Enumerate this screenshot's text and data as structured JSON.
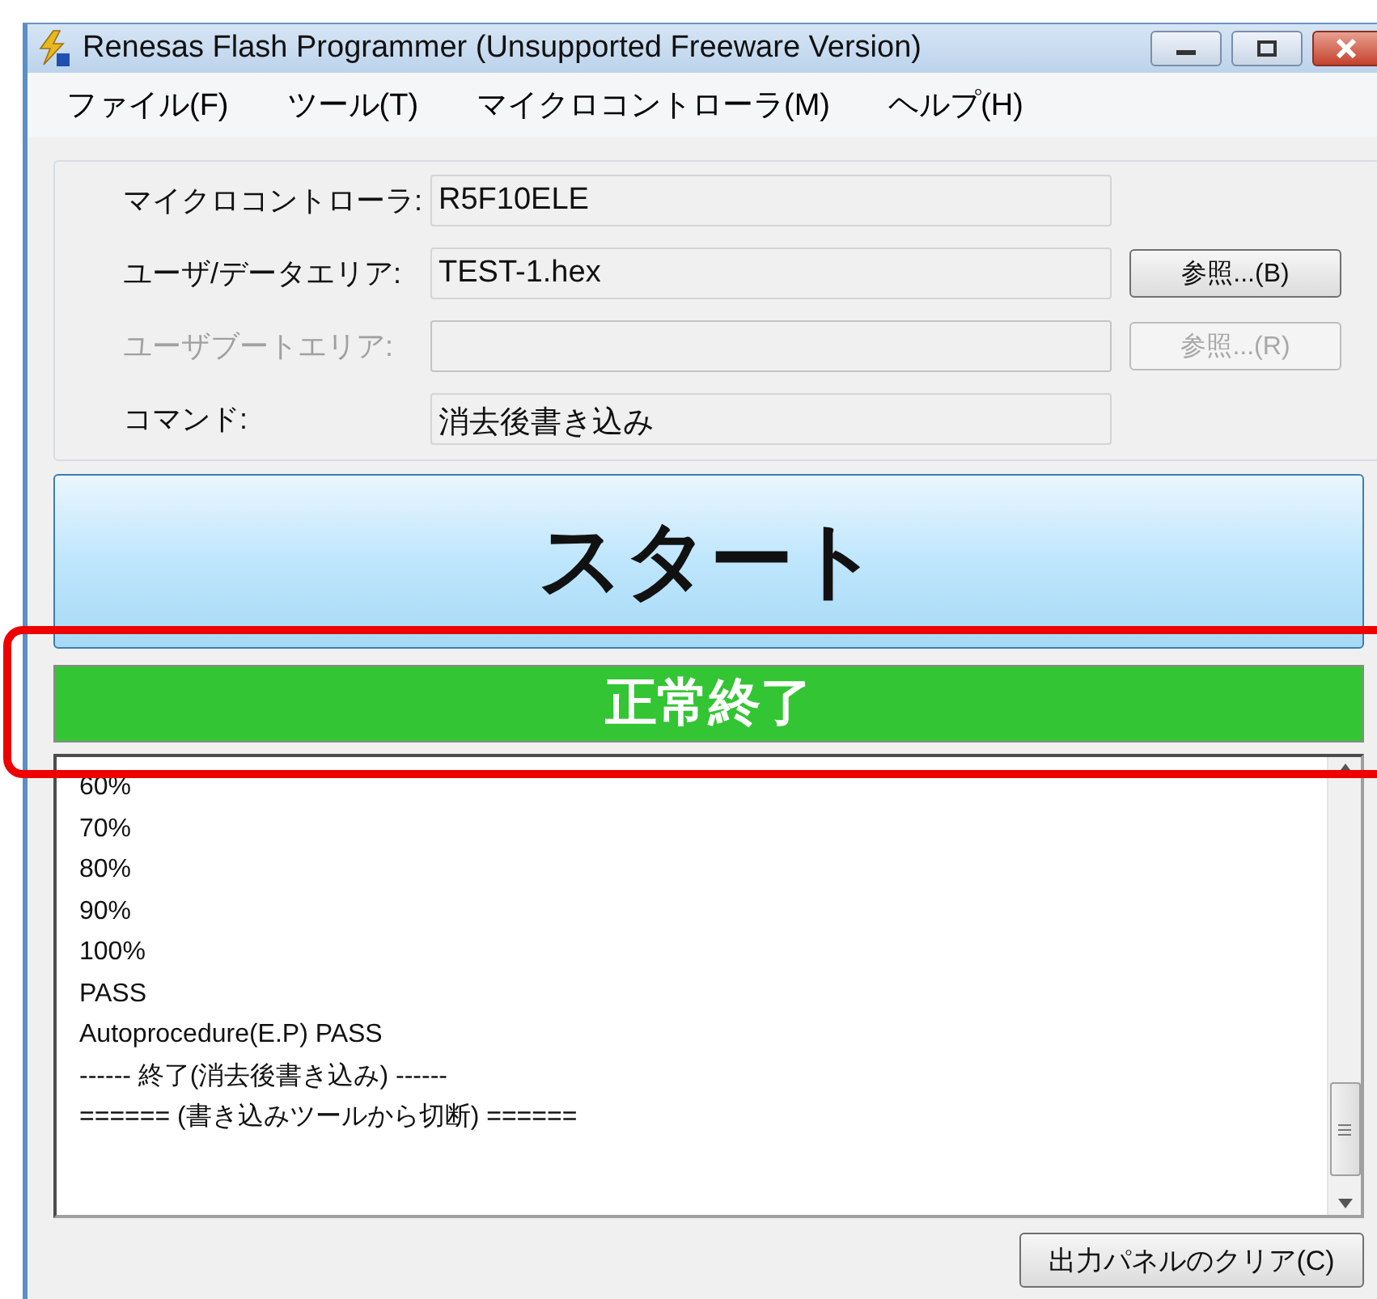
{
  "window": {
    "title": "Renesas Flash Programmer (Unsupported Freeware Version)"
  },
  "menu": [
    "ファイル(F)",
    "ツール(T)",
    "マイクロコントローラ(M)",
    "ヘルプ(H)"
  ],
  "fields": [
    {
      "label": "マイクロコントローラ:",
      "value": "R5F10ELE",
      "disabled": false
    },
    {
      "label": "ユーザ/データエリア:",
      "value": "TEST-1.hex",
      "disabled": false,
      "button": "参照...(B)"
    },
    {
      "label": "ユーザブートエリア:",
      "disabled": true,
      "button": "参照...(R)"
    },
    {
      "label": "コマンド:",
      "value": "消去後書き込み",
      "disabled": false
    }
  ],
  "start_button": "スタート",
  "status": {
    "text": "正常終了",
    "kind": "success"
  },
  "log": [
    "60%",
    "70%",
    "80%",
    "90%",
    "100%",
    "PASS",
    "Autoprocedure(E.P) PASS",
    "------ 終了(消去後書き込み) ------",
    "====== (書き込みツールから切断) ======"
  ],
  "clear_button": "出力パネルのクリア(C)"
}
